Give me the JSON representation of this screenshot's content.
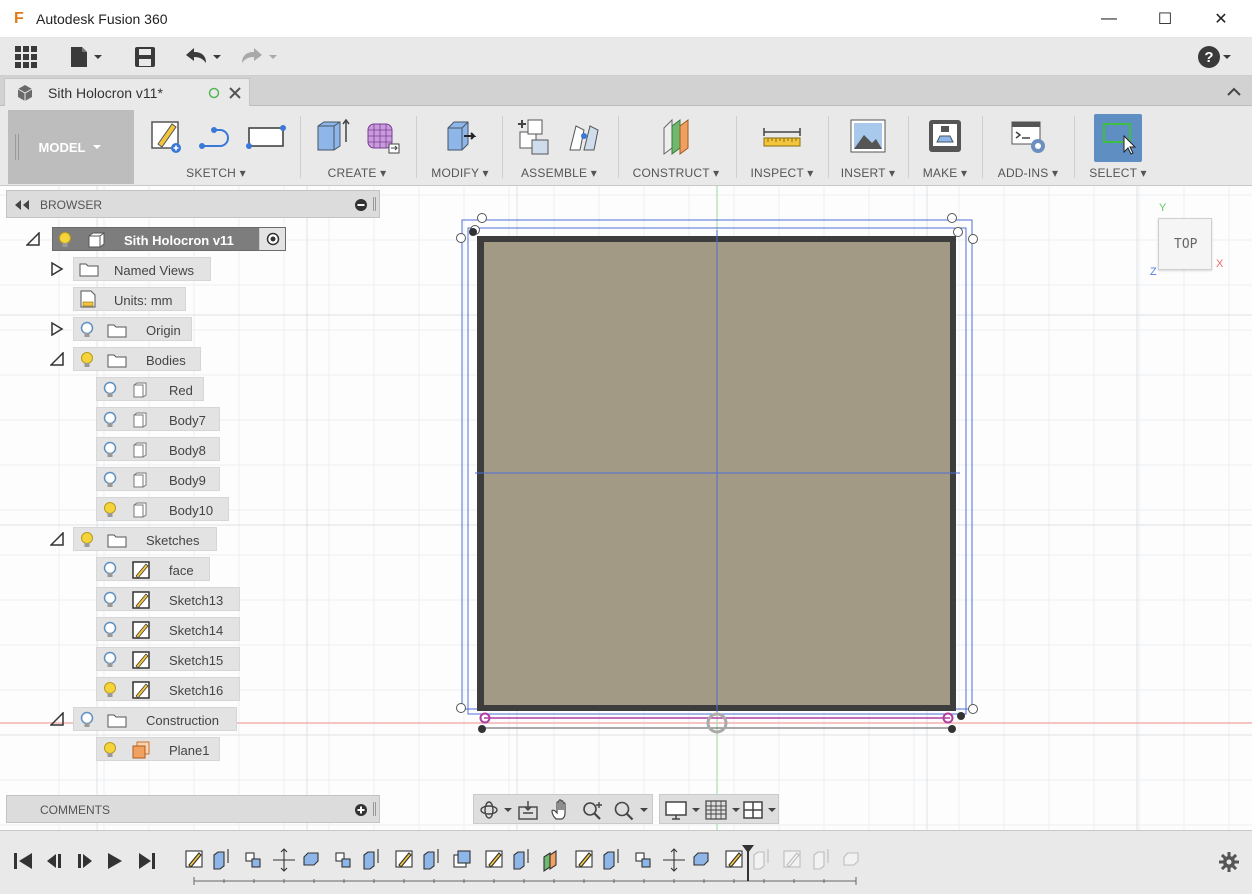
{
  "window": {
    "title": "Autodesk Fusion 360",
    "logo_letter": "F",
    "minimize": "—",
    "maximize": "☐",
    "close": "✕"
  },
  "quick_access": {
    "help": "?"
  },
  "document_tab": {
    "name": "Sith Holocron v11*"
  },
  "ribbon": {
    "workspace": "MODEL",
    "groups": [
      "SKETCH",
      "CREATE",
      "MODIFY",
      "ASSEMBLE",
      "CONSTRUCT",
      "INSPECT",
      "INSERT",
      "MAKE",
      "ADD-INS",
      "SELECT"
    ]
  },
  "browser": {
    "title": "BROWSER",
    "root": "Sith Holocron v11",
    "named_views": "Named Views",
    "units": "Units: mm",
    "origin": "Origin",
    "bodies": "Bodies",
    "body_items": [
      "Red",
      "Body7",
      "Body8",
      "Body9",
      "Body10"
    ],
    "sketches": "Sketches",
    "sketch_items": [
      "face",
      "Sketch13",
      "Sketch14",
      "Sketch15",
      "Sketch16"
    ],
    "construction": "Construction",
    "construction_items": [
      "Plane1"
    ]
  },
  "comments": {
    "title": "COMMENTS"
  },
  "viewcube": {
    "face": "TOP",
    "axis_x": "X",
    "axis_y": "Y",
    "axis_z": "Z"
  },
  "colors": {
    "model_fill": "#a39a85",
    "model_edge": "#3d3d3d",
    "sketch_line": "#4f6fd6",
    "axis_red": "#f08a8a",
    "axis_green": "#86d98a",
    "select_active": "#5f8fc2"
  }
}
